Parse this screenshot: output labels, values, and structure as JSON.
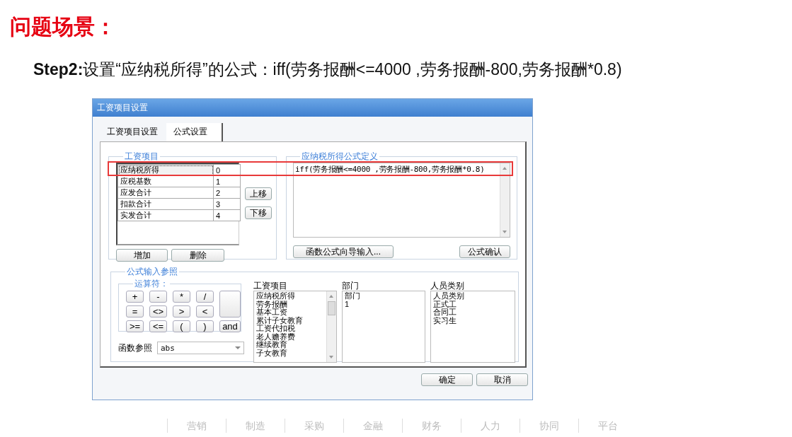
{
  "slide": {
    "title": "问题场景：",
    "step": "**Step2:**设置“应纳税所得”的公式：iff(劳务报酬<=4000 ,劳务报酬-800,劳务报酬*0.8)"
  },
  "dialog": {
    "title": "工资项目设置",
    "tabs": [
      {
        "label": "工资项目设置",
        "selected": false
      },
      {
        "label": "公式设置",
        "selected": true
      }
    ],
    "items_group": {
      "label": "工资项目",
      "rows": [
        {
          "name": "应纳税所得",
          "index": "0",
          "selected": true
        },
        {
          "name": "应税基数",
          "index": "1",
          "selected": false
        },
        {
          "name": "应发合计",
          "index": "2",
          "selected": false
        },
        {
          "name": "扣款合计",
          "index": "3",
          "selected": false
        },
        {
          "name": "实发合计",
          "index": "4",
          "selected": false
        }
      ],
      "move_buttons": [
        "上移",
        "下移"
      ],
      "buttons": [
        "增加",
        "删除"
      ]
    },
    "formula_group": {
      "label": "应纳税所得公式定义",
      "formula": "iff(劳务报酬<=4000 ,劳务报酬-800,劳务报酬*0.8)",
      "wizard_button": "函数公式向导输入...",
      "confirm_button": "公式确认"
    },
    "reference_group": {
      "label": "公式输入参照",
      "operators": {
        "label": "运算符：",
        "keys": [
          "+",
          "-",
          "*",
          "/",
          "=",
          "<>",
          ">",
          "<",
          ">=",
          "<=",
          "(",
          ")",
          "and"
        ]
      },
      "function_label": "函数参照",
      "function_value": "abs",
      "lists": [
        {
          "header": "工资项目",
          "items": [
            "应纳税所得",
            "劳务报酬",
            "基本工资",
            "累计子女教育",
            "工资代扣税",
            "老人赡养费",
            "继续教育",
            "子女教育"
          ]
        },
        {
          "header": "部门",
          "items": [
            "部门",
            "1"
          ]
        },
        {
          "header": "人员类别",
          "items": [
            "人员类别",
            "正式工",
            "合同工",
            "实习生"
          ]
        }
      ]
    },
    "buttons": [
      "确定",
      "取消"
    ]
  },
  "footer": [
    "营销",
    "制造",
    "采购",
    "金融",
    "财务",
    "人力",
    "协同",
    "平台"
  ]
}
